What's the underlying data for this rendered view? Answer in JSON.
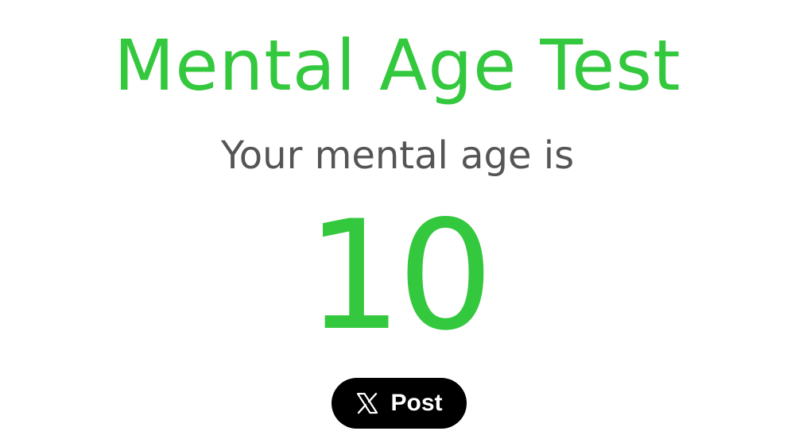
{
  "page": {
    "title": "Mental Age Test",
    "subtitle": "Your mental age is",
    "age_value": "10"
  },
  "share": {
    "post_label": "Post",
    "icon": "x-logo-icon"
  },
  "colors": {
    "accent": "#33c83d",
    "subtitle_text": "#555555",
    "button_bg": "#000000",
    "button_text": "#ffffff"
  }
}
